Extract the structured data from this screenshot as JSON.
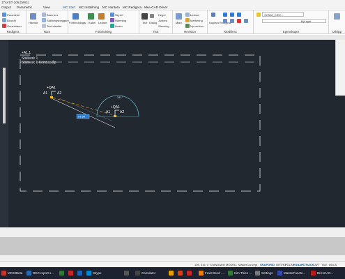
{
  "title_bar": {
    "title": "1TAVST-106.DWG]"
  },
  "menu_tabs": [
    {
      "label": "Output"
    },
    {
      "label": "Parametric"
    },
    {
      "label": "View"
    },
    {
      "label": "MC Start"
    },
    {
      "label": "MC Inställning"
    },
    {
      "label": "MC Hantera"
    },
    {
      "label": "MC Redigera"
    },
    {
      "label": "Idea CAD Driver"
    }
  ],
  "ribbon": {
    "redigera": {
      "title": "Redigera",
      "items": [
        "Parameter",
        "Blockfil",
        "Generisaen"
      ]
    },
    "ram": {
      "title": "Ram",
      "items": [
        "Hämtat",
        "Back box",
        "Ställningsbyggare",
        "Text vänster"
      ]
    },
    "forbindning": {
      "title": "Förbindning",
      "items": [
        "Förbindningar",
        "Kabel",
        "Ledare",
        "Sig.ref",
        "Hämning",
        "Noder"
      ]
    },
    "text": {
      "title": "Text",
      "items": [
        "Text",
        "Dialog",
        "Hegel",
        "Justera",
        "Stavning"
      ]
    },
    "revision": {
      "title": "Revision",
      "items": [
        "Main",
        "Ledrad",
        "Markering",
        "Ny version"
      ]
    },
    "modifiera": {
      "title": "Modifiera",
      "items": [
        "Kopiera Redigera"
      ]
    },
    "egenskaper": {
      "title": "Egenskaper",
      "layer_value": "SCS60_CIRC...",
      "linetype_value": "ByLayer"
    },
    "urklipp": {
      "title": "Urklipp"
    }
  },
  "drawing": {
    "frame_ref": "+A1.1",
    "frame_line1": "Ställverk 1",
    "frame_line2": "Ställverk 1 Kombiskåp",
    "comp1_ref": "+QA1",
    "comp1_pin_a": "A1",
    "comp1_pin_b": "A2",
    "comp2_ref": "+QA1",
    "comp2_pin_a": "A1",
    "comp2_pin_b": "A2",
    "angle_label": "341°",
    "length_label": "97.90"
  },
  "status_bar": {
    "coords": "105, 316, 0",
    "mode": "STANDARD",
    "model": "MODELL",
    "concept": "MasterConcept",
    "toggles": [
      "SNAP",
      "GRID",
      "ORTHO",
      "POLAR",
      "ESNAP",
      "STRACK",
      "LWT",
      "TILE",
      "DUCS"
    ]
  },
  "taskbar": {
    "apps": [
      {
        "label": "MC20Beta",
        "color": "#c0392b"
      },
      {
        "label": "DEO report s...",
        "color": "#2b6cb0"
      },
      {
        "label": "",
        "color": "#2e7d32"
      },
      {
        "label": "",
        "color": "#c62828"
      },
      {
        "label": "",
        "color": "#1565c0"
      },
      {
        "label": "Skype",
        "color": "#0288d1"
      },
      {
        "label": "",
        "color": "#555555"
      },
      {
        "label": "Calculator",
        "color": "#444444"
      },
      {
        "label": "",
        "color": "#e6a100"
      },
      {
        "label": "",
        "color": "#d84315"
      },
      {
        "label": "",
        "color": "#c62828"
      },
      {
        "label": "Foxit Bend -...",
        "color": "#f57c00"
      },
      {
        "label": "Kim Thien ...",
        "color": "#2e7d32"
      },
      {
        "label": "Settings",
        "color": "#777777"
      },
      {
        "label": "MasterFuncte...",
        "color": "#3949ab"
      },
      {
        "label": "BricsCAD...",
        "color": "#b71c1c"
      }
    ]
  }
}
